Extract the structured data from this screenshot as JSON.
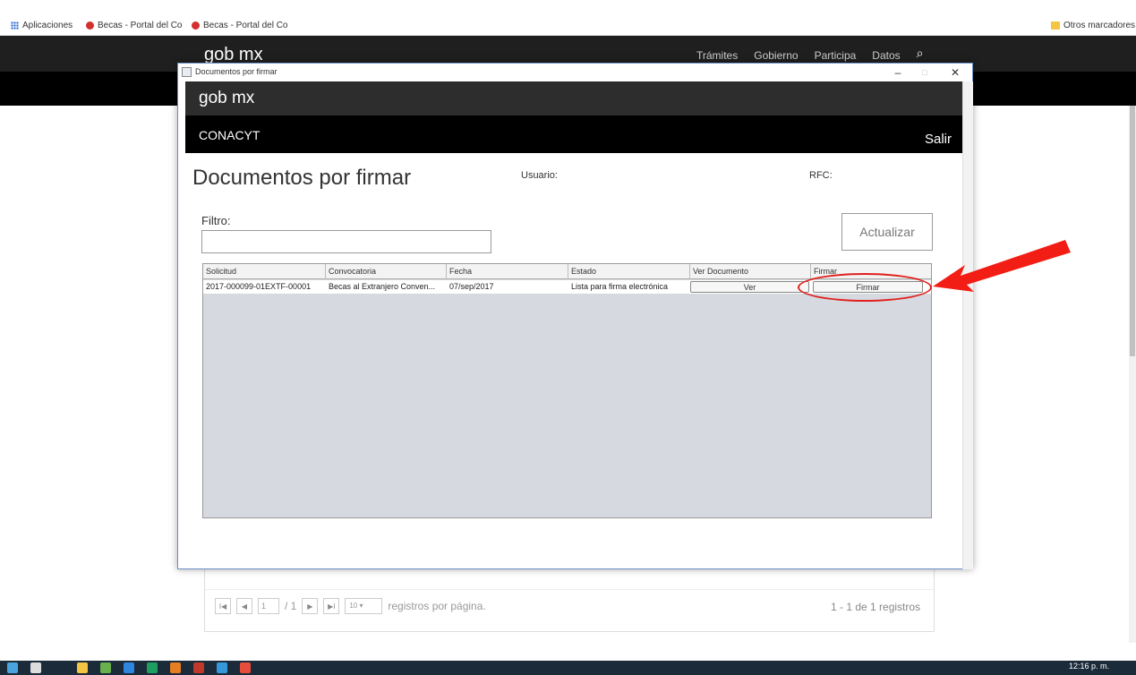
{
  "browser": {
    "bookmarks": [
      {
        "label": "Aplicaciones",
        "icon": "apps-grid-icon"
      },
      {
        "label": "Becas - Portal del Co",
        "icon": "red-circle-icon"
      },
      {
        "label": "Becas - Portal del Co",
        "icon": "red-circle-icon"
      }
    ],
    "other_bookmarks": "Otros marcadores"
  },
  "site": {
    "logo": "gob mx",
    "nav": [
      "Trámites",
      "Gobierno",
      "Participa",
      "Datos"
    ],
    "pager": {
      "first": "I◀",
      "prev": "◀",
      "page": "1",
      "of_pages": "/ 1",
      "next": "▶",
      "last": "▶I",
      "per_page": "10",
      "per_page_label": "registros por página.",
      "info": "1 - 1 de 1 registros"
    }
  },
  "dialog": {
    "window_title": "Documentos por firmar",
    "logo": "gob mx",
    "org": "CONACYT",
    "logout": "Salir",
    "heading": "Documentos por firmar",
    "user_label": "Usuario:",
    "rfc_label": "RFC:",
    "filter_label": "Filtro:",
    "filter_value": "",
    "refresh_button": "Actualizar",
    "table": {
      "columns": [
        "Solicitud",
        "Convocatoria",
        "Fecha",
        "Estado",
        "Ver Documento",
        "Firmar"
      ],
      "rows": [
        {
          "solicitud": "2017-000099-01EXTF-00001",
          "convocatoria": "Becas al Extranjero Conven...",
          "fecha": "07/sep/2017",
          "estado": "Lista para firma electrónica",
          "ver": "Ver",
          "firmar": "Firmar"
        }
      ]
    }
  },
  "taskbar": {
    "clock": "12:16 p. m."
  },
  "colors": {
    "annotation": "#e0201c",
    "header_dark": "#2d2d2d",
    "header_black": "#000000"
  }
}
